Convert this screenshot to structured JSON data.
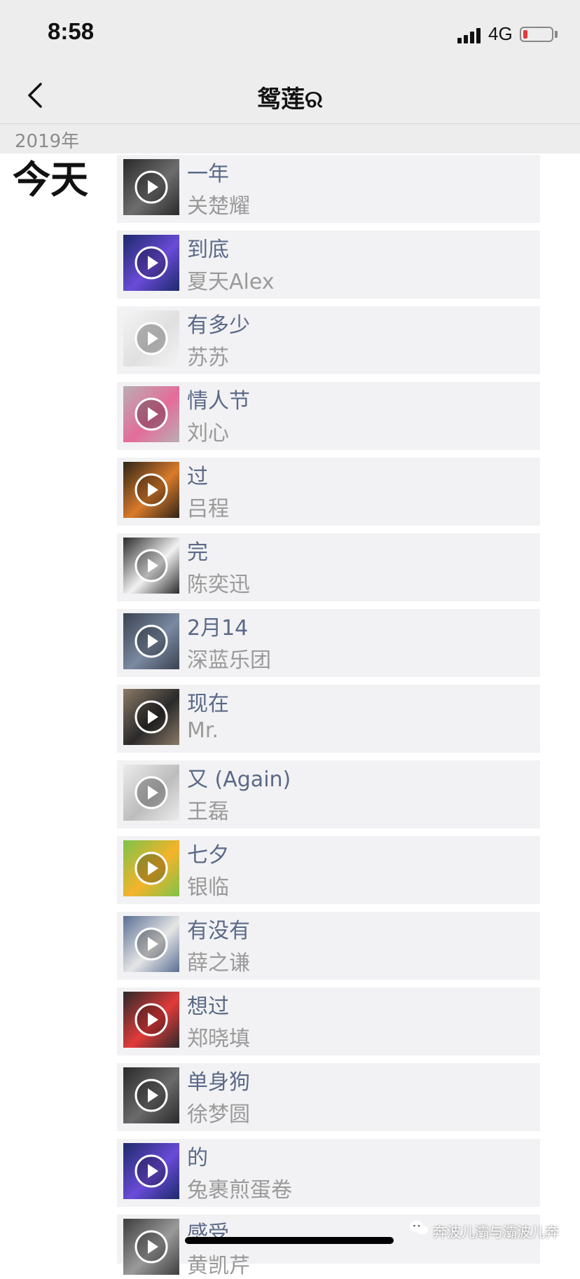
{
  "status_bar": {
    "time": "8:58",
    "network": "4G",
    "battery_level": 0.15,
    "battery_color": "#e53935",
    "signal_icon": "signal-bars-icon"
  },
  "nav": {
    "title": "鸳莲ର",
    "back_icon": "chevron-left-icon"
  },
  "timeline": {
    "year": "2019年",
    "day": "今天"
  },
  "songs": [
    {
      "title": "一年",
      "artist": "关楚耀",
      "cover_bg": "#2a2a2a",
      "cover_accent": "#6d6d6d"
    },
    {
      "title": "到底",
      "artist": "夏天Alex",
      "cover_bg": "#1d2a6b",
      "cover_accent": "#6a4bd8"
    },
    {
      "title": "有多少",
      "artist": "苏苏",
      "cover_bg": "#f4f4f4",
      "cover_accent": "#e0e0e0"
    },
    {
      "title": "情人节",
      "artist": "刘心",
      "cover_bg": "#b9aeb3",
      "cover_accent": "#e46c9a"
    },
    {
      "title": "过",
      "artist": "吕程",
      "cover_bg": "#2f2418",
      "cover_accent": "#d97b2a"
    },
    {
      "title": "完",
      "artist": "陈奕迅",
      "cover_bg": "#2b2b2b",
      "cover_accent": "#f2f2f2"
    },
    {
      "title": "2月14",
      "artist": "深蓝乐团",
      "cover_bg": "#3a4250",
      "cover_accent": "#7a8aa2"
    },
    {
      "title": "现在",
      "artist": "Mr.",
      "cover_bg": "#8b7a67",
      "cover_accent": "#2a2a2a"
    },
    {
      "title": "又 (Again)",
      "artist": "王磊",
      "cover_bg": "#ececec",
      "cover_accent": "#bdbdbd"
    },
    {
      "title": "七夕",
      "artist": "银临",
      "cover_bg": "#7dc34a",
      "cover_accent": "#f5b32a"
    },
    {
      "title": "有没有",
      "artist": "薛之谦",
      "cover_bg": "#5a6f93",
      "cover_accent": "#e6e6e6"
    },
    {
      "title": "想过",
      "artist": "郑晓填",
      "cover_bg": "#2a2a2a",
      "cover_accent": "#e23a3a"
    },
    {
      "title": "单身狗",
      "artist": "徐梦圆",
      "cover_bg": "#2a2a2a",
      "cover_accent": "#6a6a6a"
    },
    {
      "title": "的",
      "artist": "兔裹煎蛋卷",
      "cover_bg": "#1d2a6b",
      "cover_accent": "#6a4bd8"
    },
    {
      "title": "感受",
      "artist": "黄凯芹",
      "cover_bg": "#3e3e3e",
      "cover_accent": "#9a9a9a"
    }
  ],
  "watermark": {
    "text": "奔波儿灞与灞波儿奔",
    "icon": "wechat-icon"
  }
}
